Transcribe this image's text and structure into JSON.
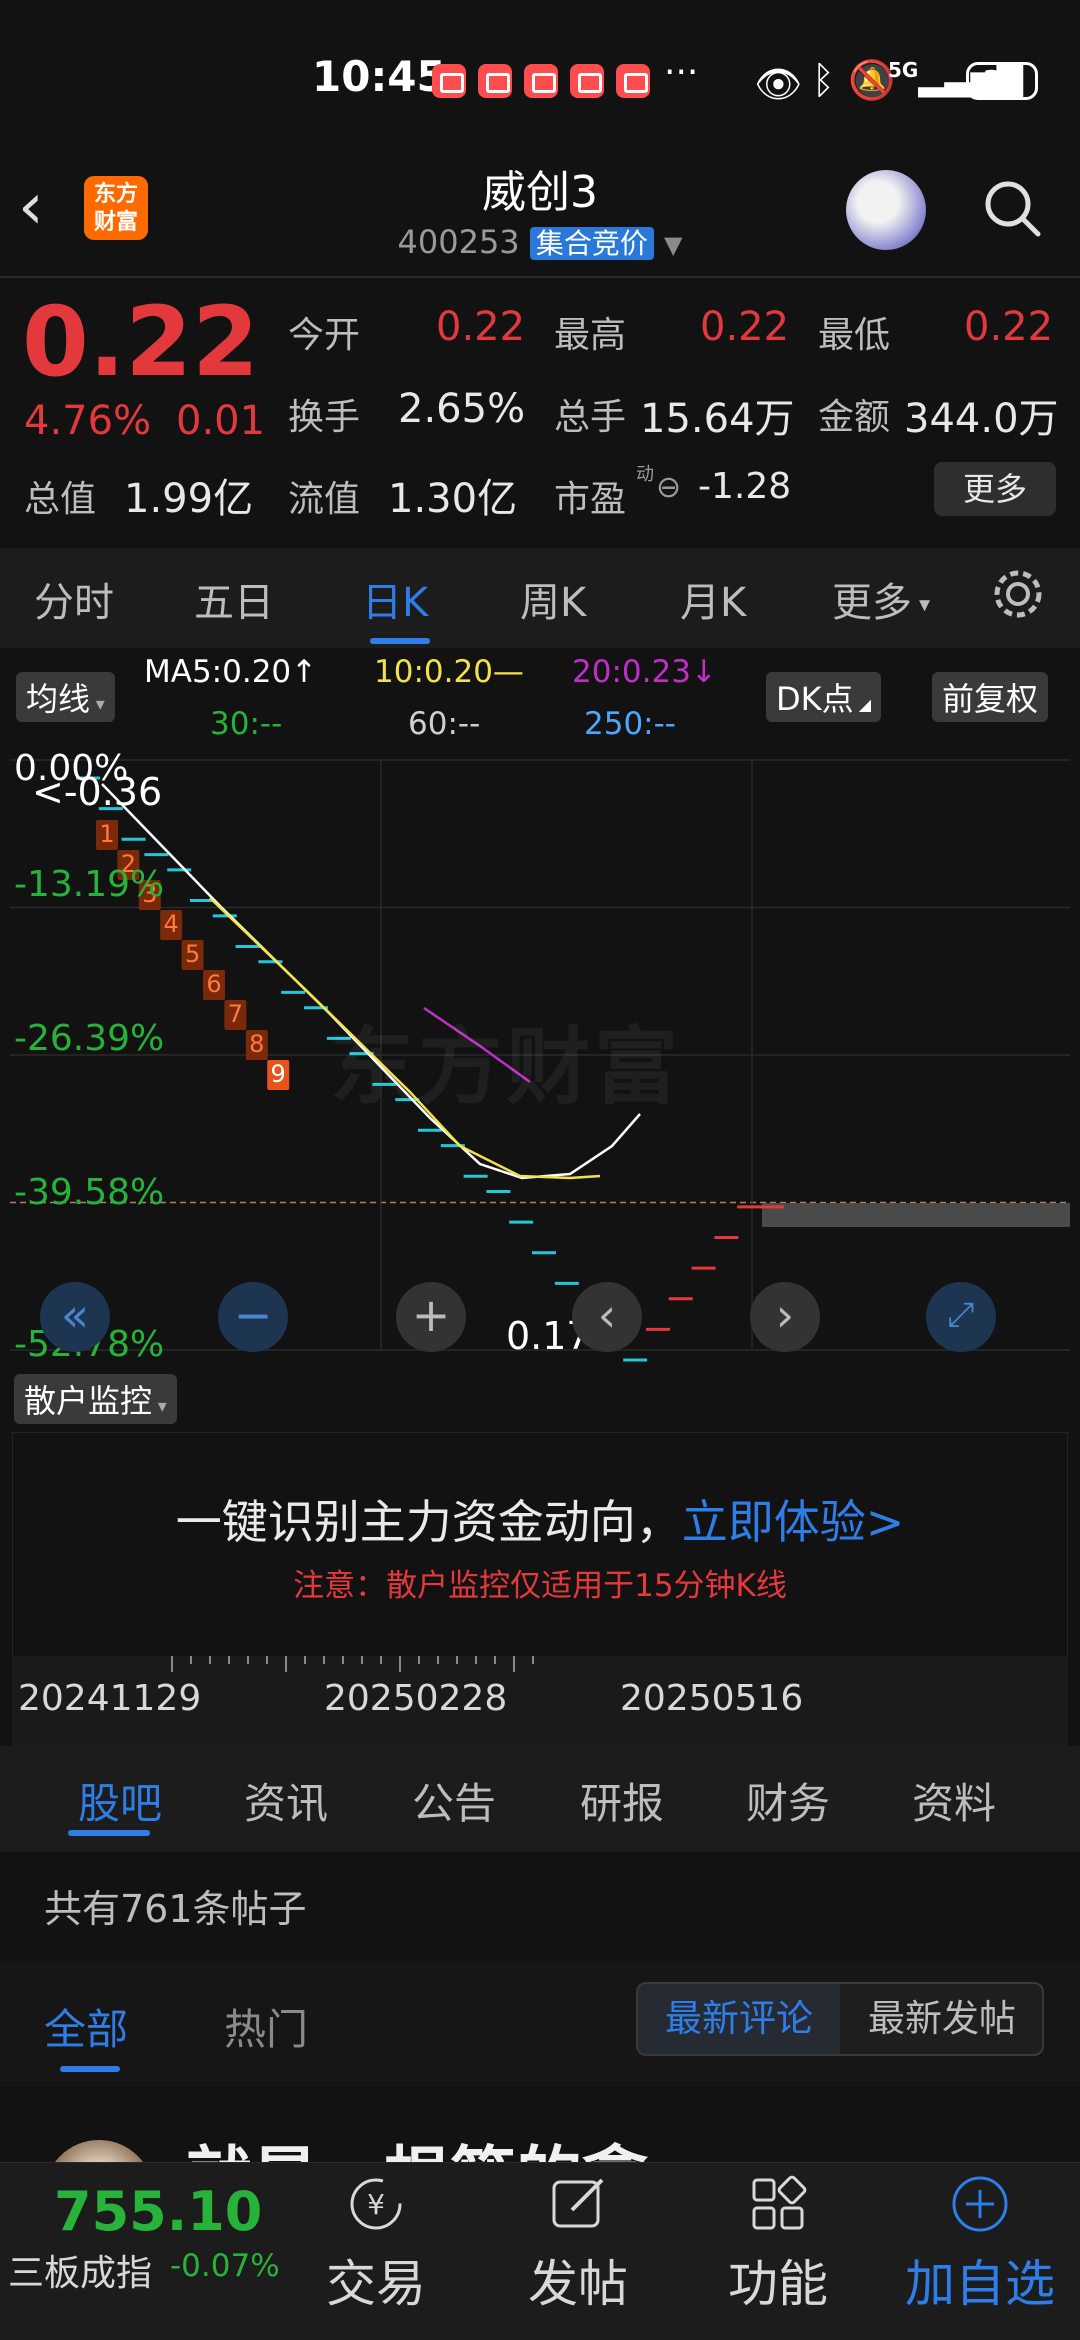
{
  "status_bar": {
    "time": "10:45",
    "network": "5G",
    "battery": "32"
  },
  "header": {
    "back_icon": "chevron-left-icon",
    "logo_text_line1": "东方",
    "logo_text_line2": "财富",
    "title": "威创3",
    "code": "400253",
    "auction_badge": "集合竞价"
  },
  "quote": {
    "price": "0.22",
    "change_pct": "4.76%",
    "change": "0.01",
    "open_label": "今开",
    "open": "0.22",
    "high_label": "最高",
    "high": "0.22",
    "low_label": "最低",
    "low": "0.22",
    "turnover_label": "换手",
    "turnover": "2.65%",
    "volume_label": "总手",
    "volume": "15.64万",
    "amount_label": "金额",
    "amount": "344.0万",
    "mktcap_label": "总值",
    "mktcap": "1.99亿",
    "float_label": "流值",
    "float": "1.30亿",
    "pe_label": "市盈",
    "pe_super": "动",
    "pe": "-1.28",
    "more_button": "更多"
  },
  "chart_tabs": [
    "分时",
    "五日",
    "日K",
    "周K",
    "月K",
    "更多"
  ],
  "active_chart_tab": "日K",
  "ma_bar": {
    "ma_button": "均线",
    "ma5": "MA5:0.20↑",
    "ma10": "10:0.20—",
    "ma20": "20:0.23↓",
    "ma30": "30:--",
    "ma60": "60:--",
    "ma250": "250:--",
    "dk_button": "DK点",
    "adjust_button": "前复权",
    "colors": {
      "ma5": "#ffffff",
      "ma10": "#f2e24a",
      "ma20": "#c02ec8",
      "ma30": "#27b23a",
      "ma60": "#cfcfcf",
      "ma250": "#4aa8ff"
    }
  },
  "chart_data": {
    "type": "candlestick",
    "y_axis_labels": [
      "0.00%",
      "-13.19%",
      "-26.39%",
      "-39.58%",
      "-52.78%"
    ],
    "annotations": {
      "high": "<-0.36",
      "low": "0.17->"
    },
    "countdown_labels": [
      "1",
      "2",
      "3",
      "4",
      "5",
      "6",
      "7",
      "8",
      "9"
    ],
    "x_axis_labels": [
      "20241129",
      "20250228",
      "20250516"
    ],
    "watermark": "东方财富",
    "candles": [
      0.36,
      0.35,
      0.34,
      0.335,
      0.33,
      0.32,
      0.315,
      0.305,
      0.3,
      0.29,
      0.285,
      0.275,
      0.27,
      0.26,
      0.255,
      0.245,
      0.24,
      0.23,
      0.225,
      0.215,
      0.205,
      0.195,
      0.19,
      0.18,
      0.17,
      0.18,
      0.19,
      0.2,
      0.21,
      0.22,
      0.22
    ],
    "ylim": [
      0.17,
      0.36
    ]
  },
  "chart_controls": [
    "rewind-icon",
    "zoom-out-icon",
    "zoom-in-icon",
    "chevron-left-icon",
    "chevron-right-icon",
    "fullscreen-icon"
  ],
  "monitor": {
    "selector": "散户监控",
    "main_text": "一键识别主力资金动向，",
    "link_text": "立即体验>",
    "note": "注意：散户监控仅适用于15分钟K线"
  },
  "news_tabs": [
    "股吧",
    "资讯",
    "公告",
    "研报",
    "财务",
    "资料"
  ],
  "active_news_tab": "股吧",
  "posts": {
    "count_text": "共有761条帖子",
    "filter_all": "全部",
    "filter_hot": "热门",
    "sort_latest_comment": "最新评论",
    "sort_latest_post": "最新发帖",
    "first_post_title": "就是一根筷的拿"
  },
  "bottom_bar": {
    "index_value": "755.10",
    "index_name": "三板成指",
    "index_change": "-0.07%",
    "items": [
      {
        "label": "交易",
        "icon": "trade-icon"
      },
      {
        "label": "发帖",
        "icon": "compose-icon"
      },
      {
        "label": "功能",
        "icon": "grid-icon"
      },
      {
        "label": "加自选",
        "icon": "add-favorite-icon"
      }
    ]
  }
}
